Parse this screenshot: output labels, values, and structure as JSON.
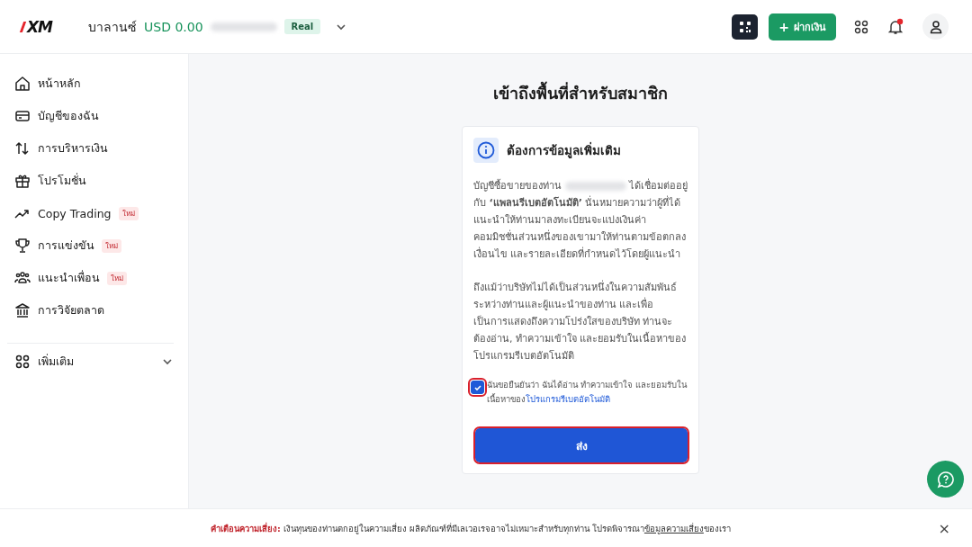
{
  "header": {
    "logo": "XM",
    "balance_label": "บาลานซ์",
    "balance_value": "USD 0.00",
    "account_type": "Real",
    "deposit_plus": "+",
    "deposit_button": "ฝากเงิน",
    "notification_unread": true
  },
  "sidebar": {
    "items": [
      {
        "label": "หน้าหลัก",
        "kind": "home"
      },
      {
        "label": "บัญชีของฉัน",
        "kind": "card"
      },
      {
        "label": "การบริหารเงิน",
        "kind": "arrows"
      },
      {
        "label": "โปรโมชั่น",
        "kind": "gift"
      },
      {
        "label": "Copy Trading",
        "kind": "trend",
        "badge": "ใหม่"
      },
      {
        "label": "การแข่งขัน",
        "kind": "trophy",
        "badge": "ใหม่"
      },
      {
        "label": "แนะนำเพื่อน",
        "kind": "people",
        "badge": "ใหม่"
      },
      {
        "label": "การวิจัยตลาด",
        "kind": "bank"
      }
    ],
    "more": {
      "label": "เพิ่มเติม",
      "expanded": false
    }
  },
  "main": {
    "title": "เข้าถึงพื้นที่สำหรับสมาชิก",
    "card": {
      "heading": "ต้องการข้อมูลเพิ่มเติม",
      "paragraph_1_start": "บัญชีซื้อขายของท่าน",
      "paragraph_1_end": "ได้เชื่อมต่ออยู่กับ **‘แพลนรีเบตอัตโนมัติ’** นั่นหมายความว่าผู้ที่ได้แนะนำให้ท่านมาลงทะเบียนจะแบ่งเงินค่าคอมมิชชั่นส่วนหนึ่งของเขามาให้ท่านตามข้อตกลง เงื่อนไข และรายละเอียดที่กำหนดไว้โดยผู้แนะนำ",
      "paragraph_2": "ถึงแม้ว่าบริษัทไม่ได้เป็นส่วนหนึ่งในความสัมพันธ์ระหว่างท่านและผู้แนะนำของท่าน และเพื่อเป็นการแสดงถึงความโปร่งใสของบริษัท ท่านจะต้องอ่าน, ทำความเข้าใจ และยอมรับในเนื้อหาของโปรแกรมรีเบตอัตโนมัติ",
      "consent": {
        "checked": true,
        "text": "ฉันขอยืนยันว่า ฉันได้อ่าน ทำความเข้าใจ และยอมรับในเนื้อหาของ",
        "link": "โปรแกรมรีเบตอัตโนมัติ"
      },
      "submit_button": "ส่ง"
    }
  },
  "risk_warning": {
    "label": "คำเตือนความเสี่ยง:",
    "text": "เงินทุนของท่านตกอยู่ในความเสี่ยง ผลิตภัณฑ์ที่มีเลเวอเรจอาจไม่เหมาะสำหรับทุกท่าน โปรดพิจารณา",
    "link": "ข้อมูลความเสี่ยง",
    "text_end": "ของเรา",
    "close": "×"
  }
}
